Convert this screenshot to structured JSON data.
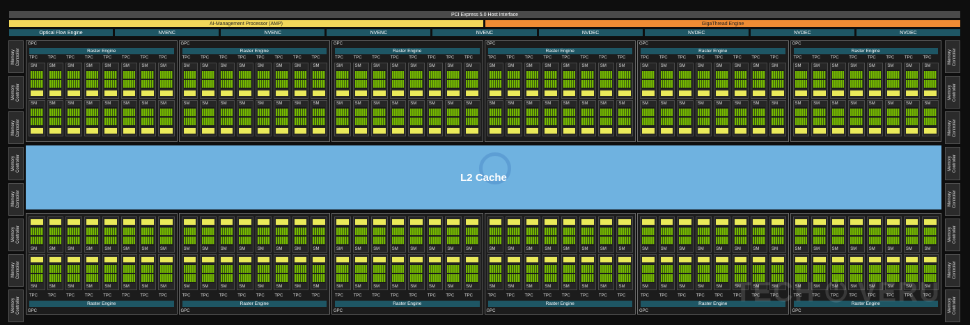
{
  "header": {
    "pcie": "PCI Express 5.0 Host Interface",
    "amp": "AI-Management Processor (AMP)",
    "gigathread": "GigaThread Engine"
  },
  "units": [
    "Optical Flow Engine",
    "NVENC",
    "NVENC",
    "NVENC",
    "NVENC",
    "NVDEC",
    "NVDEC",
    "NVDEC",
    "NVDEC"
  ],
  "memory_controller_label": "Memory\nController",
  "memory_controllers_per_side": 8,
  "gpc": {
    "label": "GPC",
    "raster_engine": "Raster Engine",
    "tpc_label": "TPC",
    "sm_label": "SM",
    "gpcs_per_row": 6,
    "tpcs_per_gpc": 8,
    "sms_per_tpc": 2
  },
  "l2": {
    "label": "L2 Cache"
  },
  "watermark": "TECH ⏻ VERU",
  "colors": {
    "amp": "#f2d75a",
    "gigathread": "#ef8c34",
    "unit": "#1e5664",
    "l2": "#6fb2e0",
    "cuda_core": "#76b900",
    "rt_core": "#eaea5a"
  }
}
